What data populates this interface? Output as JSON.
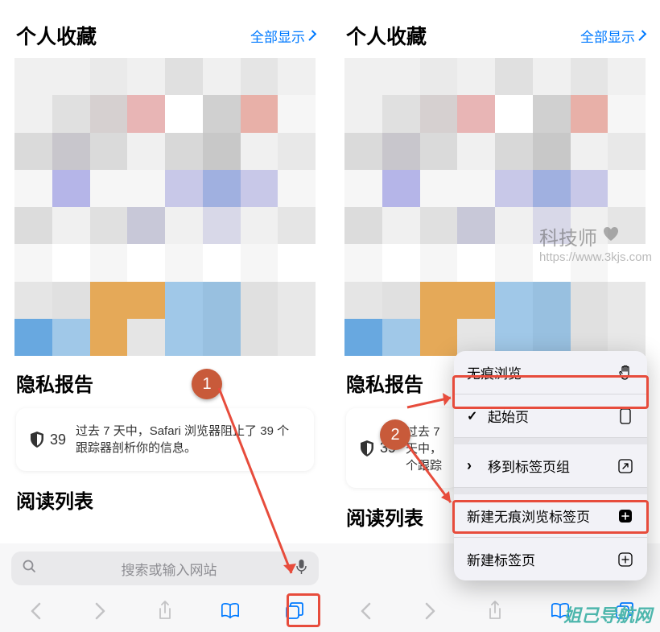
{
  "header": {
    "title": "个人收藏",
    "show_all": "全部显示"
  },
  "privacy": {
    "title": "隐私报告",
    "count": "39",
    "text": "过去 7 天中，Safari 浏览器阻止了 39 个跟踪器剖析你的信息。",
    "text_short": "过去 7 天中，",
    "text_short2": "个跟踪"
  },
  "read": {
    "title": "阅读列表"
  },
  "search": {
    "placeholder": "搜索或输入网站"
  },
  "menu": {
    "private": "无痕浏览",
    "start_page": "起始页",
    "move_to_group": "移到标签页组",
    "new_private_tab": "新建无痕浏览标签页",
    "new_tab": "新建标签页"
  },
  "callouts": {
    "one": "1",
    "two": "2"
  },
  "watermark": {
    "title": "科技师",
    "url": "https://www.3kjs.com"
  },
  "bottom_watermark": "姐己导航网",
  "pixel_colors": [
    "#f0f0f0",
    "#f0f0f0",
    "#eaeaea",
    "#f0f0f0",
    "#e0e0e0",
    "#f0f0f0",
    "#e5e5e5",
    "#f0f0f0",
    "#f0f0f0",
    "#e0e0e0",
    "#d6d0d0",
    "#e8b5b5",
    "#ffffff",
    "#d0d0d0",
    "#e8b0a8",
    "#f6f6f6",
    "#dadada",
    "#c8c6cc",
    "#dadada",
    "#f0f0f0",
    "#d8d8d8",
    "#c8c8c8",
    "#f0f0f0",
    "#e8e8e8",
    "#f6f6f6",
    "#b5b5e8",
    "#f6f6f6",
    "#f6f6f6",
    "#c8c8e8",
    "#a0b0e0",
    "#c8c8e8",
    "#f6f6f6",
    "#dcdcdc",
    "#f0f0f0",
    "#e0e0e0",
    "#c8c8d8",
    "#f0f0f0",
    "#d8d8e8",
    "#f0f0f0",
    "#e5e5e5",
    "#f6f6f6",
    "#ffffff",
    "#f6f6f6",
    "#ffffff",
    "#f6f6f6",
    "#ffffff",
    "#f6f6f6",
    "#ffffff",
    "#e5e5e5",
    "#e0e0e0",
    "#e5a958",
    "#e5a958",
    "#a0c8e8",
    "#98c0e0",
    "#e0e0e0",
    "#e8e8e8",
    "#68a8e0",
    "#a0c8e8",
    "#e5a958",
    "#e5e5e5",
    "#a0c8e8",
    "#98c0e0",
    "#e0e0e0",
    "#e8e8e8"
  ]
}
